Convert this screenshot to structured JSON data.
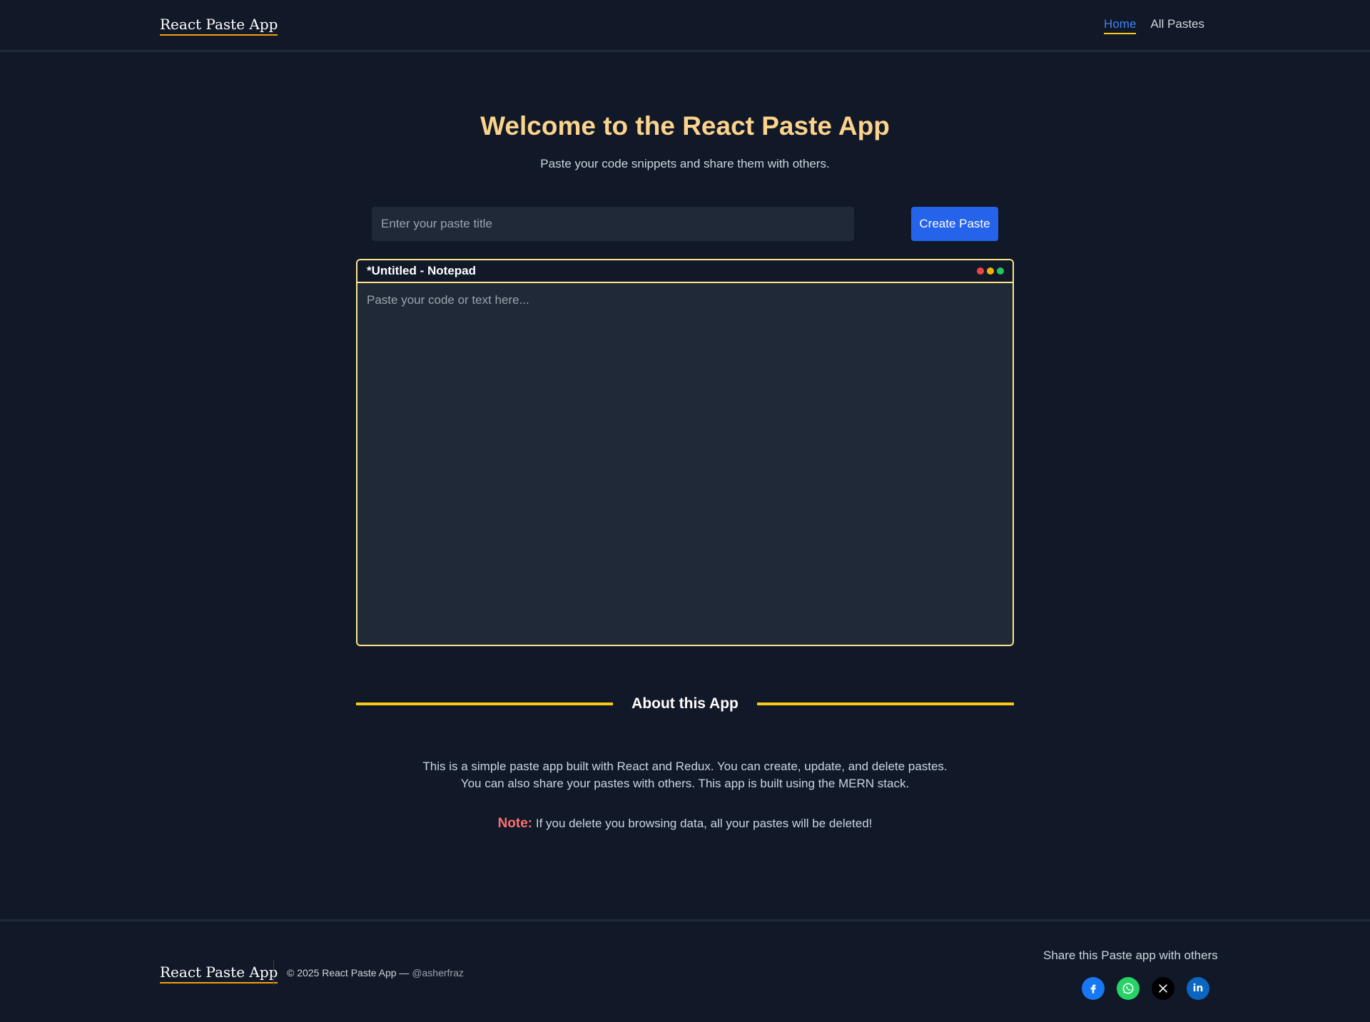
{
  "header": {
    "brand": "React Paste App",
    "nav": [
      {
        "label": "Home",
        "active": true
      },
      {
        "label": "All Pastes",
        "active": false
      }
    ]
  },
  "hero": {
    "title": "Welcome to the React Paste App",
    "subtitle": "Paste your code snippets and share them with others."
  },
  "form": {
    "title_placeholder": "Enter your paste title",
    "title_value": "",
    "create_label": "Create Paste"
  },
  "notepad": {
    "window_title": "*Untitled - Notepad",
    "placeholder": "Paste your code or text here...",
    "content": ""
  },
  "about": {
    "heading": "About this App",
    "line1": "This is a simple paste app built with React and Redux. You can create, update, and delete pastes.",
    "line2": "You can also share your pastes with others. This app is built using the MERN stack.",
    "note_label": "Note:",
    "note_text": " If you delete you browsing data, all your pastes will be deleted!"
  },
  "footer": {
    "brand": "React Paste App",
    "copyright": "© 2025 React Paste App — ",
    "handle": "@asherfraz",
    "share_text": "Share this Paste app with others",
    "socials": [
      {
        "name": "facebook-icon",
        "color": "#1877f2"
      },
      {
        "name": "whatsapp-icon",
        "color": "#25d366"
      },
      {
        "name": "x-icon",
        "color": "#000000"
      },
      {
        "name": "linkedin-icon",
        "color": "#0a66c2"
      }
    ]
  },
  "colors": {
    "background": "#111827",
    "accent_yellow": "#facc15",
    "primary_blue": "#2563eb",
    "title_gradient": "#fcd38d",
    "note_red": "#f87171"
  }
}
